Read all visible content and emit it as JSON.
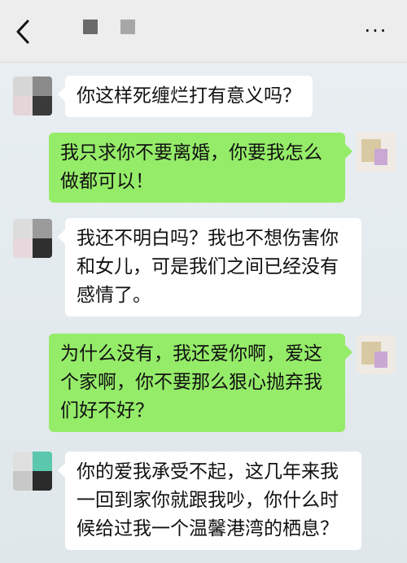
{
  "header": {
    "back_icon": "chevron-left-icon",
    "more_label": "···",
    "title_blocks": [
      "#6a6a6a",
      "#a7a7a7"
    ]
  },
  "colors": {
    "incoming_bubble": "#ffffff",
    "outgoing_bubble": "#95ec69",
    "background": "#e8eef1"
  },
  "messages": [
    {
      "side": "in",
      "lines": [
        "你这样死缠烂打有意义吗？"
      ]
    },
    {
      "side": "out",
      "lines": [
        "我只求你不要离婚，你要我怎么",
        "做都可以！"
      ]
    },
    {
      "side": "in",
      "lines": [
        "我还不明白吗？我也不想伤害你",
        "和女儿，可是我们之间已经没有",
        "感情了。"
      ]
    },
    {
      "side": "out",
      "lines": [
        "为什么没有，我还爱你啊，爱这",
        "个家啊，你不要那么狠心抛弃我",
        "们好不好？"
      ]
    },
    {
      "side": "in",
      "lines": [
        "你的爱我承受不起，这几年来我",
        "一回到家你就跟我吵，你什么时",
        "候给过我一个温馨港湾的栖息？"
      ]
    }
  ]
}
